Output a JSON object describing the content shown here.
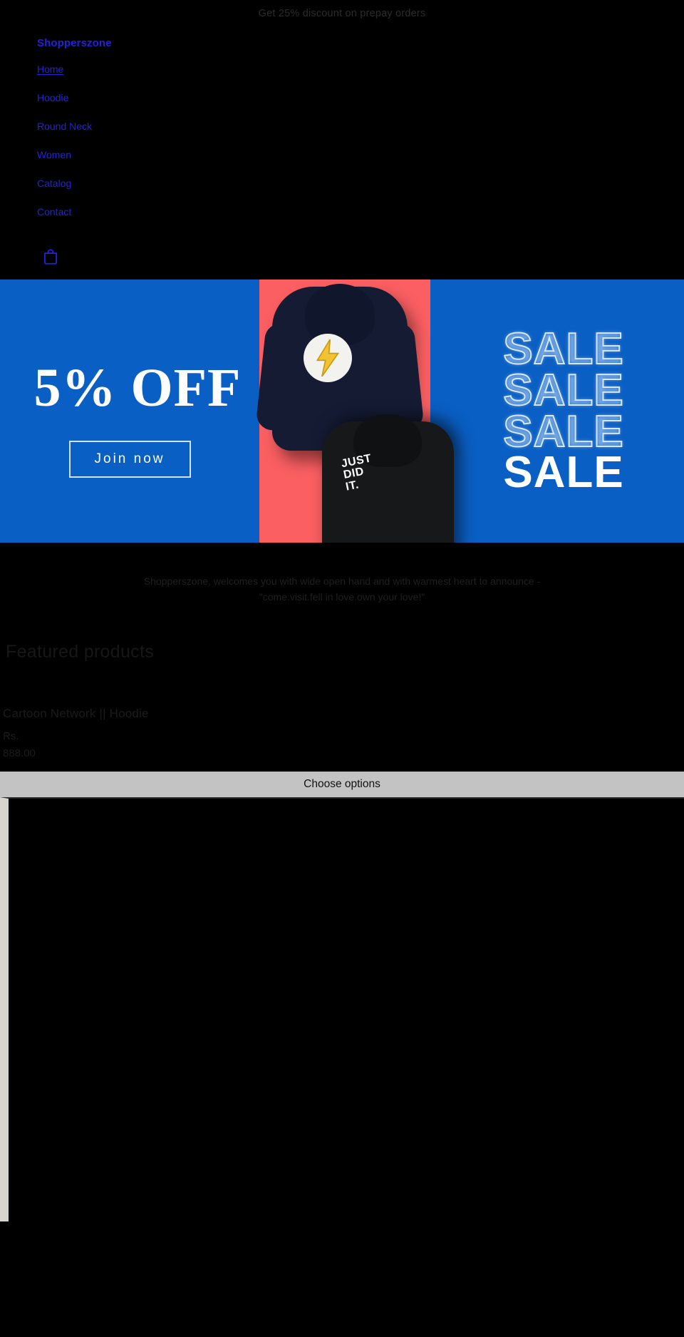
{
  "announcement": {
    "text": "Get 25% discount on prepay orders"
  },
  "header": {
    "brand": "Shopperszone",
    "nav": [
      {
        "label": "Home",
        "active": true
      },
      {
        "label": "Hoodie",
        "active": false
      },
      {
        "label": "Round Neck",
        "active": false
      },
      {
        "label": "Women",
        "active": false
      },
      {
        "label": "Catalog",
        "active": false
      },
      {
        "label": "Contact",
        "active": false
      }
    ],
    "cart_icon": "shopping-bag-icon"
  },
  "hero": {
    "discount": "5% OFF",
    "cta_label": "Join now",
    "sale_lines": [
      "SALE",
      "SALE",
      "SALE",
      "SALE"
    ],
    "hoodie_b_text_line1": "JUST",
    "hoodie_b_text_line2": "DID",
    "hoodie_b_text_line3": "IT.",
    "colors": {
      "blue": "#0a5fc4",
      "coral": "#fb5f62",
      "navy": "#141b33",
      "outline": "#d6e7fb"
    }
  },
  "welcome": {
    "line1": "Shopperszone, welcomes you with wide open hand and with warmest heart to announce -",
    "line2": "\"come.visit.fell in love.own your love!\""
  },
  "featured": {
    "title": "Featured products",
    "products": [
      {
        "title": "Cartoon Network || Hoodie",
        "price_currency": "Rs.",
        "price_amount": "888.00",
        "cta": "Choose options"
      }
    ]
  }
}
